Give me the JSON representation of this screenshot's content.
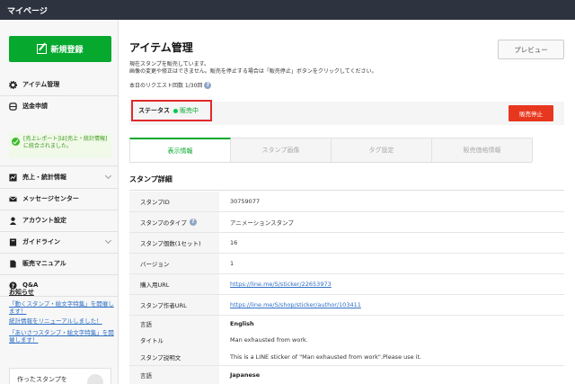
{
  "topbar": {
    "title": "マイページ"
  },
  "sidebar": {
    "new_button": "新規登録",
    "items": [
      {
        "label": "アイテム管理",
        "icon": "gear-icon"
      },
      {
        "label": "送金申請",
        "icon": "database-icon"
      },
      {
        "label": "売上・統計情報",
        "icon": "chart-icon"
      },
      {
        "label": "メッセージセンター",
        "icon": "mail-icon"
      },
      {
        "label": "アカウント設定",
        "icon": "user-icon"
      },
      {
        "label": "ガイドライン",
        "icon": "book-icon"
      },
      {
        "label": "販売マニュアル",
        "icon": "document-icon"
      },
      {
        "label": "Q&A",
        "icon": "question-icon"
      }
    ],
    "notice": "[売上レポート]は[売上・統計情報]に統合されました。",
    "news": {
      "title": "お知らせ",
      "links": [
        "「動くスタンプ・絵文字特集」を開催します！",
        "統計情報をリニューアルしました！",
        "「あいさつスタンプ・絵文字特集」を開催します！"
      ]
    },
    "stamp_box": "作ったスタンプを"
  },
  "main": {
    "title": "アイテム管理",
    "preview_button": "プレビュー",
    "description_line1": "現在スタンプを販売しています。",
    "description_line2": "画像の変更や修正はできません。販売を停止する場合は「販売停止」ボタンをクリックしてください。",
    "requests_label": "本日のリクエスト回数 1/30回",
    "status": {
      "label": "ステータス",
      "value": "販売中"
    },
    "stop_button": "販売停止",
    "tabs": [
      "表示情報",
      "スタンプ画像",
      "タグ設定",
      "販売価格情報"
    ],
    "section_title": "スタンプ詳細",
    "details": [
      {
        "key": "スタンプID",
        "value": "30759077"
      },
      {
        "key": "スタンプのタイプ",
        "value": "アニメーションスタンプ"
      },
      {
        "key": "スタンプ個数(1セット)",
        "value": "16"
      },
      {
        "key": "バージョン",
        "value": "1"
      },
      {
        "key": "購入用URL",
        "value": "https://line.me/S/sticker/22653973"
      },
      {
        "key": "スタンプ作者URL",
        "value": "https://line.me/S/shop/sticker/author/103411"
      },
      {
        "key": "言語",
        "value": "English"
      },
      {
        "key": "タイトル",
        "value": "Man exhausted from work."
      },
      {
        "key": "スタンプ説明文",
        "value": "This is a LINE sticker of \"Man exhausted from work\".Please use it."
      },
      {
        "key": "言語",
        "value": "Japanese"
      }
    ]
  },
  "colors": {
    "accent": "#06a82e",
    "danger": "#e8371f",
    "topbar": "#2d3440",
    "link": "#2f6fc4"
  }
}
